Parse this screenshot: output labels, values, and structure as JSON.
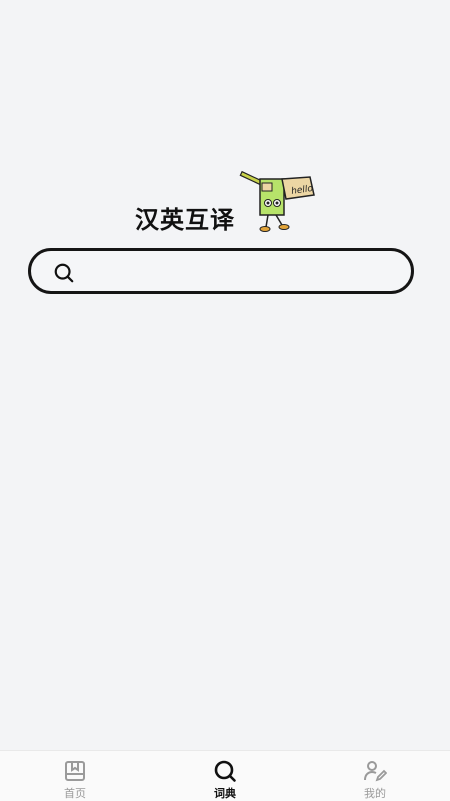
{
  "hero": {
    "title": "汉英互译",
    "mascot_text": "hello"
  },
  "search": {
    "value": "",
    "placeholder": ""
  },
  "tabbar": {
    "tabs": [
      {
        "label": "首页",
        "icon": "bookmark-box-icon",
        "active": false
      },
      {
        "label": "词典",
        "icon": "search-icon",
        "active": true
      },
      {
        "label": "我的",
        "icon": "user-edit-icon",
        "active": false
      }
    ]
  },
  "colors": {
    "background": "#f3f4f6",
    "accent": "#111111",
    "inactive": "#9a9a9a",
    "mascot_green": "#b7e36a",
    "mascot_tan": "#ecd6a4"
  }
}
